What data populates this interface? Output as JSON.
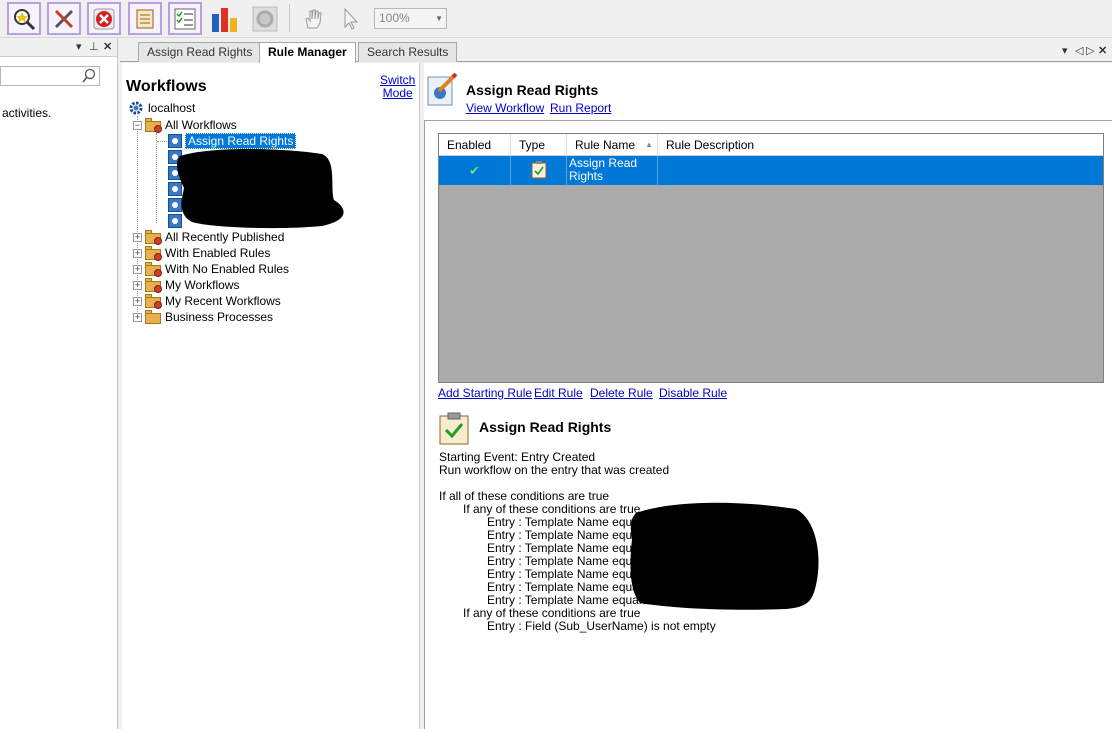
{
  "toolbar": {
    "zoom": "100%",
    "buttons": [
      "search-favorites-icon",
      "tools-icon",
      "stop-icon",
      "properties-icon",
      "checklist-icon",
      "report-chart-icon",
      "settings-gear-icon",
      "pan-hand-icon",
      "pointer-icon"
    ]
  },
  "left_pane": {
    "activities_text": "activities."
  },
  "tabs": [
    {
      "label": "Assign Read Rights",
      "active": false
    },
    {
      "label": "Rule Manager",
      "active": true
    },
    {
      "label": "Search Results",
      "active": false
    }
  ],
  "tree": {
    "title": "Workflows",
    "switch_mode": [
      "Switch",
      "Mode"
    ],
    "server": "localhost",
    "all_workflows": "All Workflows",
    "selected_workflow": "Assign Read Rights",
    "folders": [
      "All Recently Published",
      "With Enabled Rules",
      "With No Enabled Rules",
      "My Workflows",
      "My Recent Workflows",
      "Business Processes"
    ]
  },
  "rule_panel": {
    "title": "Assign Read Rights",
    "view_workflow": "View Workflow",
    "run_report": "Run Report",
    "columns": [
      "Enabled",
      "Type",
      "Rule Name",
      "Rule Description"
    ],
    "rows": [
      {
        "enabled": "✔",
        "rule_name": "Assign Read Rights",
        "rule_description": ""
      }
    ],
    "actions": [
      "Add Starting Rule",
      "Edit Rule",
      "Delete Rule",
      "Disable Rule"
    ]
  },
  "detail": {
    "title": "Assign Read Rights",
    "starting_event": "Starting Event: Entry Created",
    "run_text": "Run workflow on the entry that was created",
    "all_conditions": "If all of these conditions are true",
    "any_conditions_1": "If any of these conditions are true",
    "template_conditions": [
      "Entry : Template Name equals",
      "Entry : Template Name equals",
      "Entry : Template Name equals",
      "Entry : Template Name equals",
      "Entry : Template Name equals",
      "Entry : Template Name equals",
      "Entry : Template Name equals"
    ],
    "any_conditions_2": "If any of these conditions are true",
    "field_condition": "Entry : Field (Sub_UserName) is not empty"
  },
  "colors": {
    "selection": "#0078d7",
    "grid_bg": "#ababab",
    "link": "#0000cc"
  }
}
